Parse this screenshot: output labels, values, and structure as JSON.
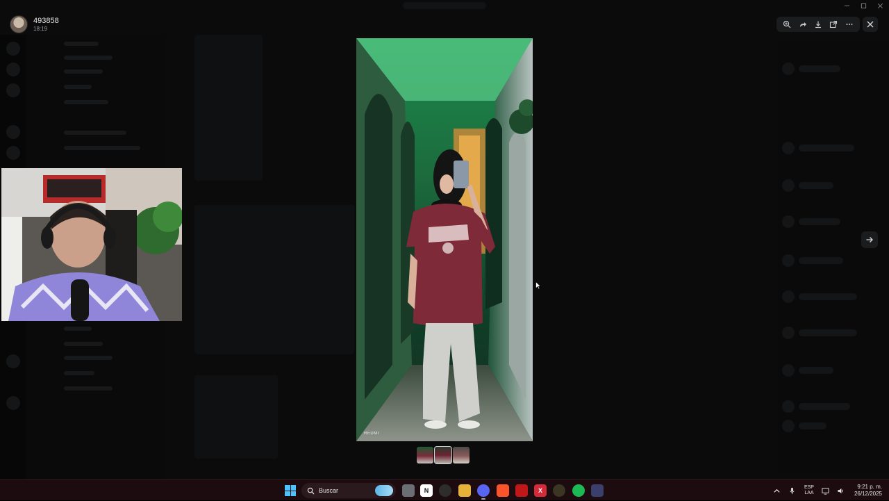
{
  "user": {
    "name": "493858",
    "time": "18:19"
  },
  "viewer": {
    "toolbar": [
      {
        "name": "zoom-in-icon"
      },
      {
        "name": "forward-icon"
      },
      {
        "name": "download-icon"
      },
      {
        "name": "open-external-icon"
      },
      {
        "name": "more-icon"
      }
    ],
    "close_icon": "close-icon",
    "next_icon": "arrow-right-icon",
    "image_watermark": "REDMI",
    "thumbnails": 3,
    "active_thumbnail": 2
  },
  "taskbar": {
    "search_placeholder": "Buscar",
    "apps": [
      {
        "name": "file-explorer-app"
      },
      {
        "name": "notion-app",
        "label": "N"
      },
      {
        "name": "obs-app"
      },
      {
        "name": "folder-app"
      },
      {
        "name": "discord-app"
      },
      {
        "name": "brave-app"
      },
      {
        "name": "news-app"
      },
      {
        "name": "x-app",
        "label": "X"
      },
      {
        "name": "settings-app"
      },
      {
        "name": "spotify-app"
      },
      {
        "name": "stack-app"
      }
    ],
    "lang_primary": "ESP",
    "lang_secondary": "LAA",
    "time": "9:21 p. m.",
    "date": "26/12/2025"
  },
  "colors": {
    "accent": "#4cc2ff",
    "taskbar_bg": "#1c0c10",
    "discord": "#5865f2",
    "spotify": "#1db954"
  }
}
